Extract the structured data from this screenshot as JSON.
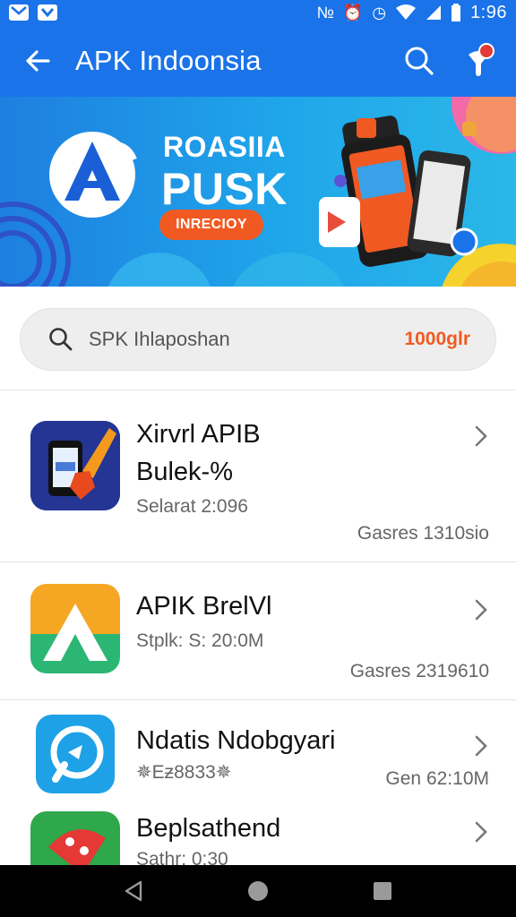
{
  "status_bar": {
    "time": "1:96"
  },
  "app_bar": {
    "title": "APK Indoonsia",
    "notification_badge_color": "#e53935"
  },
  "banner": {
    "title_line1": "ROASIIA",
    "title_line2": "PUSK",
    "cta_label": "INRECIOY",
    "accent": "#f05a22"
  },
  "search": {
    "placeholder": "SPK Ihlaposhan",
    "count": "1000glr"
  },
  "apps": [
    {
      "name_line1": "Xirvrl APIB",
      "name_line2": "Bulek-%",
      "size": "Selarat 2:096",
      "meta": "Gasres 1310sio",
      "icon": "phone-pen-icon"
    },
    {
      "name_line1": "APIK BrelVl",
      "name_line2": "",
      "size": "Stplk: S: 20:0M",
      "meta": "Gasres 2319610",
      "icon": "apk-a-icon"
    },
    {
      "name_line1": "Ndatis Ndobgyari",
      "name_line2": "",
      "size": "✵Eƶ8833✵",
      "meta": "Gen 62:10M",
      "icon": "chat-bubble-icon"
    },
    {
      "name_line1": "Beplsathend",
      "name_line2": "",
      "size": "Sathr: 0:30",
      "meta": "",
      "icon": "rocket-icon"
    }
  ],
  "colors": {
    "primary": "#1a73e8",
    "accent": "#f05a22"
  }
}
